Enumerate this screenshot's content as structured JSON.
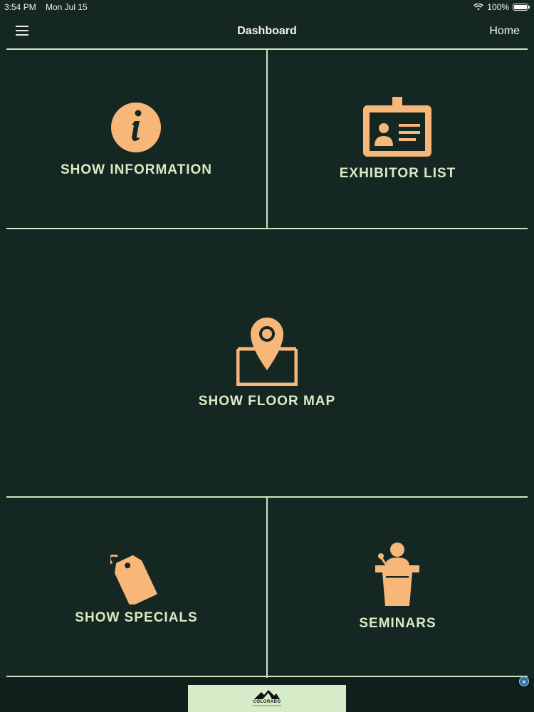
{
  "status_bar": {
    "time": "3:54 PM",
    "date": "Mon Jul 15",
    "battery": "100%",
    "battery_level": 1.0
  },
  "nav": {
    "title": "Dashboard",
    "home_label": "Home",
    "menu_icon": "hamburger-menu-icon"
  },
  "tiles": {
    "show_information": {
      "label": "SHOW INFORMATION",
      "icon": "info-icon"
    },
    "exhibitor_list": {
      "label": "EXHIBITOR LIST",
      "icon": "id-badge-icon"
    },
    "show_floor_map": {
      "label": "SHOW FLOOR MAP",
      "icon": "map-pin-icon"
    },
    "show_specials": {
      "label": "SHOW SPECIALS",
      "icon": "price-tag-icon"
    },
    "seminars": {
      "label": "SEMINARS",
      "icon": "podium-speaker-icon"
    }
  },
  "banner": {
    "brand": "COLORADO",
    "sub": "EXTRACTION SYSTEMS",
    "logo_icon": "mountain-logo-icon"
  },
  "colors": {
    "background": "#142722",
    "divider": "#cfe5bf",
    "icon": "#f6b779",
    "label": "#d9ecc4"
  }
}
